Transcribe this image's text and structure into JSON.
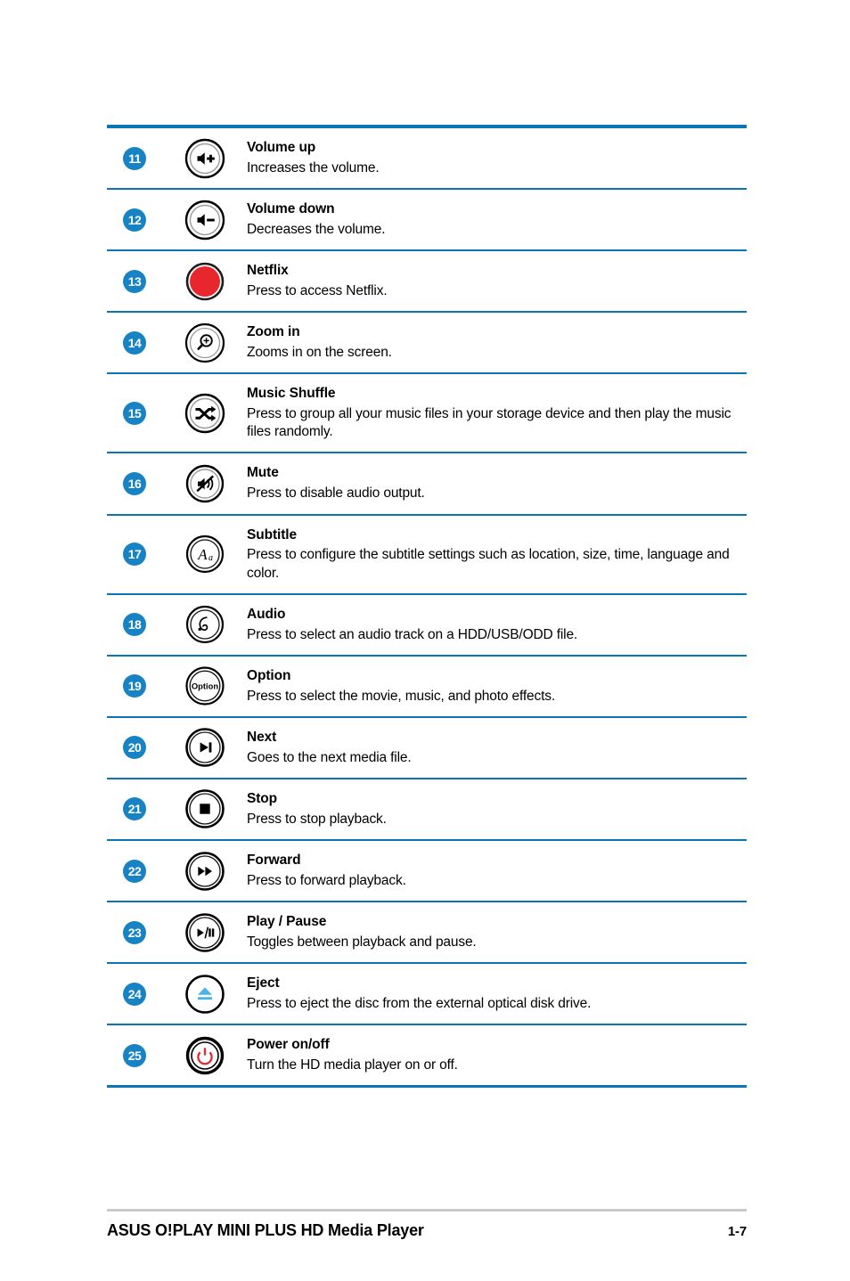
{
  "colors": {
    "rule_blue": "#0b75b6",
    "badge_blue": "#1883c4",
    "netflix_red": "#e8262d",
    "eject_blue": "#4bb3e5",
    "power_red": "#e02b33",
    "footer_rule_gray": "#c9c9c9"
  },
  "rows": [
    {
      "number": "11",
      "icon": "volume-up-icon",
      "title": "Volume up",
      "desc": "Increases the volume."
    },
    {
      "number": "12",
      "icon": "volume-down-icon",
      "title": "Volume down",
      "desc": "Decreases the volume."
    },
    {
      "number": "13",
      "icon": "netflix-icon",
      "title": "Netflix",
      "desc": "Press to access Netflix."
    },
    {
      "number": "14",
      "icon": "zoom-in-icon",
      "title": "Zoom in",
      "desc": "Zooms in on the screen."
    },
    {
      "number": "15",
      "icon": "shuffle-icon",
      "title": "Music Shuffle",
      "desc": "Press to group all your music files in your storage device and then play the music files randomly."
    },
    {
      "number": "16",
      "icon": "mute-icon",
      "title": "Mute",
      "desc": "Press to disable audio output."
    },
    {
      "number": "17",
      "icon": "subtitle-icon",
      "title": "Subtitle",
      "desc": "Press to configure the subtitle settings such as location, size, time, language and color."
    },
    {
      "number": "18",
      "icon": "audio-icon",
      "title": "Audio",
      "desc": "Press to select an audio track on a HDD/USB/ODD file."
    },
    {
      "number": "19",
      "icon": "option-icon",
      "title": "Option",
      "desc": "Press to select the movie, music, and photo effects.",
      "icon_label": "Option"
    },
    {
      "number": "20",
      "icon": "next-icon",
      "title": "Next",
      "desc": "Goes to the next media file."
    },
    {
      "number": "21",
      "icon": "stop-icon",
      "title": "Stop",
      "desc": "Press to stop playback."
    },
    {
      "number": "22",
      "icon": "forward-icon",
      "title": "Forward",
      "desc": "Press to forward playback."
    },
    {
      "number": "23",
      "icon": "play-pause-icon",
      "title": "Play / Pause",
      "desc": "Toggles between playback and pause."
    },
    {
      "number": "24",
      "icon": "eject-icon",
      "title": "Eject",
      "desc": "Press to eject the disc from the external optical disk drive."
    },
    {
      "number": "25",
      "icon": "power-icon",
      "title": "Power on/off",
      "desc": "Turn the HD media player on or off."
    }
  ],
  "footer": {
    "title": "ASUS O!PLAY MINI PLUS HD Media Player",
    "page": "1-7"
  }
}
